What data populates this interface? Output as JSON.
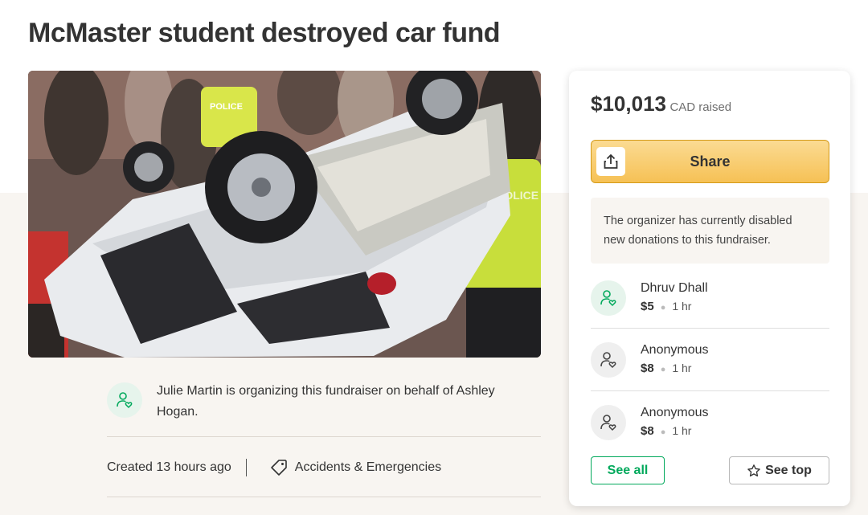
{
  "page": {
    "title": "McMaster student destroyed car fund"
  },
  "hero_image": {
    "police_label_1": "POLICE",
    "police_label_2": "POLICE"
  },
  "organizer": {
    "text": "Julie Martin is organizing this fundraiser on behalf of Ashley Hogan.",
    "icon": "user-heart-icon"
  },
  "meta": {
    "created": "Created 13 hours ago",
    "category": "Accidents & Emergencies",
    "category_icon": "tag-icon"
  },
  "donation_card": {
    "amount": "$10,013",
    "amount_label": "CAD raised",
    "share_label": "Share",
    "share_icon": "share-upload-icon",
    "notice": "The organizer has currently disabled new donations to this fundraiser.",
    "donors": [
      {
        "name": "Dhruv Dhall",
        "amount": "$5",
        "time": "1 hr",
        "icon": "user-heart-icon"
      },
      {
        "name": "Anonymous",
        "amount": "$8",
        "time": "1 hr",
        "icon": "user-heart-icon"
      },
      {
        "name": "Anonymous",
        "amount": "$8",
        "time": "1 hr",
        "icon": "user-heart-icon"
      }
    ],
    "see_all_label": "See all",
    "see_top_label": "See top",
    "see_top_icon": "star-icon"
  },
  "colors": {
    "brand_green": "#02a95c",
    "share_yellow": "#f6c155",
    "beige_background": "#f8f5f1",
    "text_dark": "#333333"
  }
}
